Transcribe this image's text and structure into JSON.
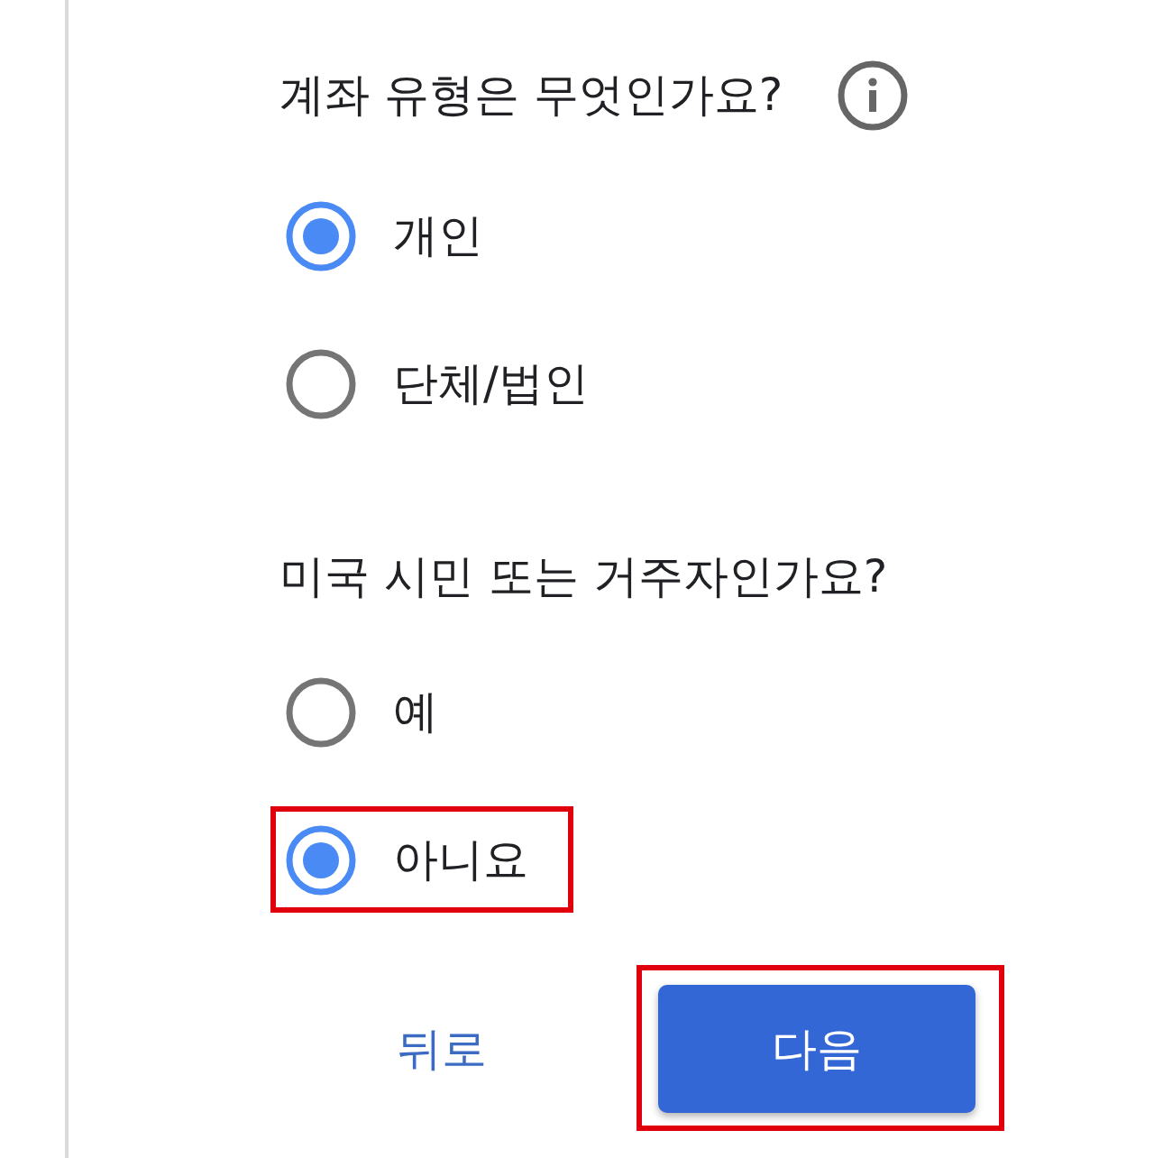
{
  "questions": [
    {
      "text": "계좌 유형은 무엇인가요?",
      "info": true,
      "options": [
        {
          "label": "개인",
          "selected": true,
          "highlighted": false
        },
        {
          "label": "단체/법인",
          "selected": false,
          "highlighted": false
        }
      ]
    },
    {
      "text": "미국 시민 또는 거주자인가요?",
      "info": false,
      "options": [
        {
          "label": "예",
          "selected": false,
          "highlighted": false
        },
        {
          "label": "아니요",
          "selected": true,
          "highlighted": true
        }
      ]
    }
  ],
  "buttons": [
    {
      "label": "뒤로",
      "kind": "text",
      "highlighted": false
    },
    {
      "label": "다음",
      "kind": "primary",
      "highlighted": true
    }
  ]
}
